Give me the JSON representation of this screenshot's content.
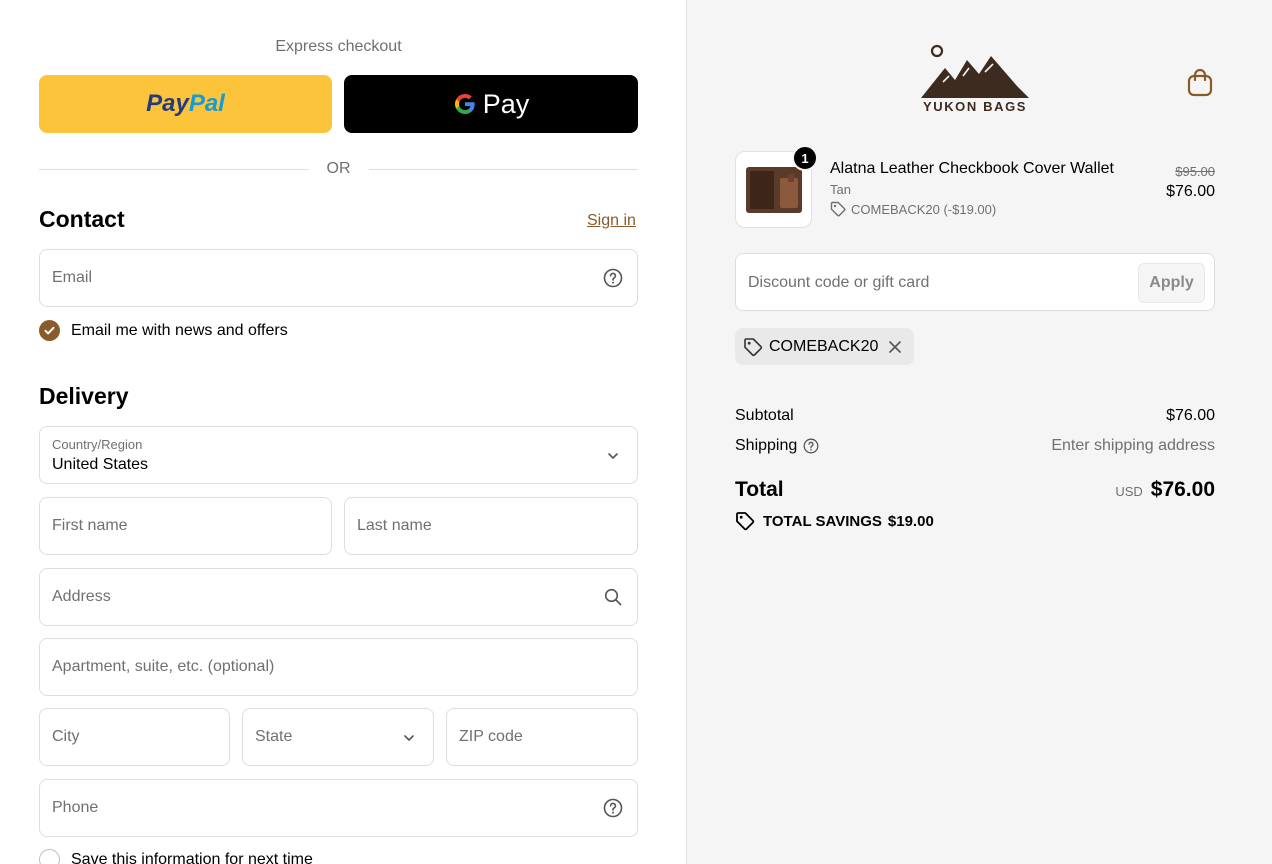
{
  "express": {
    "title": "Express checkout",
    "paypal_part1": "Pay",
    "paypal_part2": "Pal",
    "gpay_label": "Pay",
    "or_label": "OR"
  },
  "contact": {
    "title": "Contact",
    "signin_label": "Sign in",
    "email_placeholder": "Email",
    "news_checkbox_label": "Email me with news and offers",
    "news_checked": true
  },
  "delivery": {
    "title": "Delivery",
    "country_label": "Country/Region",
    "country_value": "United States",
    "first_name_placeholder": "First name",
    "last_name_placeholder": "Last name",
    "address_placeholder": "Address",
    "apartment_placeholder": "Apartment, suite, etc. (optional)",
    "city_placeholder": "City",
    "state_placeholder": "State",
    "zip_placeholder": "ZIP code",
    "phone_placeholder": "Phone",
    "save_info_label": "Save this information for next time"
  },
  "brand": {
    "name": "YUKON BAGS",
    "color": "#8b5a2b"
  },
  "order": {
    "item": {
      "quantity": "1",
      "name": "Alatna Leather Checkbook Cover Wallet",
      "variant": "Tan",
      "discount": "COMEBACK20 (-$19.00)",
      "original_price": "$95.00",
      "price": "$76.00"
    },
    "discount_placeholder": "Discount code or gift card",
    "apply_label": "Apply",
    "applied_code": "COMEBACK20",
    "subtotal_label": "Subtotal",
    "subtotal_value": "$76.00",
    "shipping_label": "Shipping",
    "shipping_value": "Enter shipping address",
    "total_label": "Total",
    "currency": "USD",
    "total_value": "$76.00",
    "savings_label": "TOTAL SAVINGS",
    "savings_value": "$19.00"
  }
}
